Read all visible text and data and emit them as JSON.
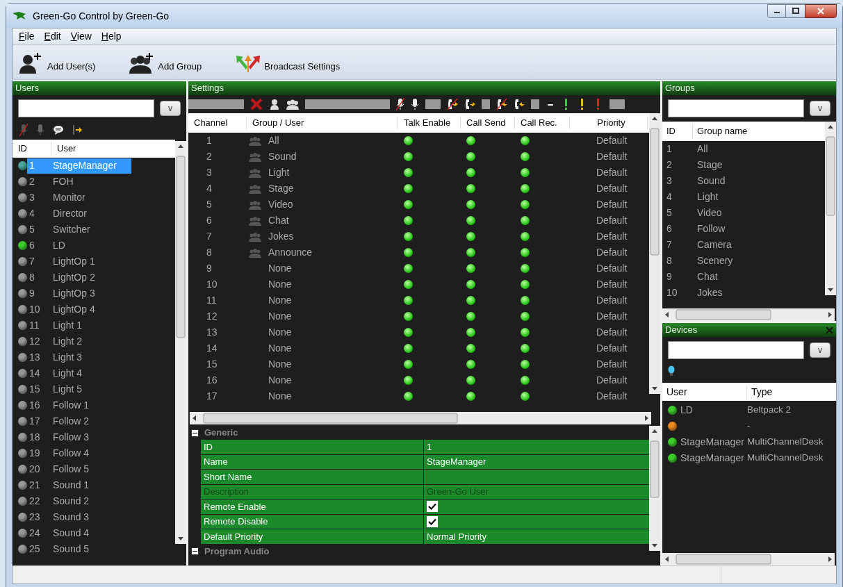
{
  "window": {
    "title": "Green-Go Control by Green-Go"
  },
  "menu": [
    "File",
    "Edit",
    "View",
    "Help"
  ],
  "toolbar": [
    {
      "kind": "user",
      "label": "Add User(s)"
    },
    {
      "kind": "group",
      "label": "Add Group"
    },
    {
      "kind": "broadcast",
      "label": "Broadcast Settings"
    }
  ],
  "users": {
    "title": "Users",
    "filter_button": "v",
    "columns": [
      "ID",
      "User"
    ],
    "rows": [
      {
        "id": "1",
        "name": "StageManager",
        "color": "#4aa6a0",
        "selected": true
      },
      {
        "id": "2",
        "name": "FOH",
        "color": "#9a9a9a",
        "selected": false
      },
      {
        "id": "3",
        "name": "Monitor",
        "color": "#9a9a9a",
        "selected": false
      },
      {
        "id": "4",
        "name": "Director",
        "color": "#9a9a9a",
        "selected": false
      },
      {
        "id": "5",
        "name": "Switcher",
        "color": "#9a9a9a",
        "selected": false
      },
      {
        "id": "6",
        "name": "LD",
        "color": "#3ccf2a",
        "selected": false
      },
      {
        "id": "7",
        "name": "LightOp 1",
        "color": "#9a9a9a",
        "selected": false
      },
      {
        "id": "8",
        "name": "LightOp 2",
        "color": "#9a9a9a",
        "selected": false
      },
      {
        "id": "9",
        "name": "LightOp 3",
        "color": "#9a9a9a",
        "selected": false
      },
      {
        "id": "10",
        "name": "LightOp 4",
        "color": "#9a9a9a",
        "selected": false
      },
      {
        "id": "11",
        "name": "Light 1",
        "color": "#9a9a9a",
        "selected": false
      },
      {
        "id": "12",
        "name": "Light 2",
        "color": "#9a9a9a",
        "selected": false
      },
      {
        "id": "13",
        "name": "Light 3",
        "color": "#9a9a9a",
        "selected": false
      },
      {
        "id": "14",
        "name": "Light 4",
        "color": "#9a9a9a",
        "selected": false
      },
      {
        "id": "15",
        "name": "Light 5",
        "color": "#9a9a9a",
        "selected": false
      },
      {
        "id": "16",
        "name": "Follow 1",
        "color": "#9a9a9a",
        "selected": false
      },
      {
        "id": "17",
        "name": "Follow 2",
        "color": "#9a9a9a",
        "selected": false
      },
      {
        "id": "18",
        "name": "Follow 3",
        "color": "#9a9a9a",
        "selected": false
      },
      {
        "id": "19",
        "name": "Follow 4",
        "color": "#9a9a9a",
        "selected": false
      },
      {
        "id": "20",
        "name": "Follow 5",
        "color": "#9a9a9a",
        "selected": false
      },
      {
        "id": "21",
        "name": "Sound 1",
        "color": "#9a9a9a",
        "selected": false
      },
      {
        "id": "22",
        "name": "Sound 2",
        "color": "#9a9a9a",
        "selected": false
      },
      {
        "id": "23",
        "name": "Sound 3",
        "color": "#9a9a9a",
        "selected": false
      },
      {
        "id": "24",
        "name": "Sound 4",
        "color": "#9a9a9a",
        "selected": false
      },
      {
        "id": "25",
        "name": "Sound 5",
        "color": "#9a9a9a",
        "selected": false
      }
    ]
  },
  "settings": {
    "title": "Settings",
    "columns": [
      "Channel",
      "Group / User",
      "Talk Enable",
      "Call Send",
      "Call Rec.",
      "Priority"
    ],
    "rows": [
      {
        "channel": "1",
        "kind": "group",
        "name": "All",
        "talk_enable": true,
        "call_send": true,
        "call_rec": true,
        "priority": "Default"
      },
      {
        "channel": "2",
        "kind": "group",
        "name": "Sound",
        "talk_enable": true,
        "call_send": true,
        "call_rec": true,
        "priority": "Default"
      },
      {
        "channel": "3",
        "kind": "group",
        "name": "Light",
        "talk_enable": true,
        "call_send": true,
        "call_rec": true,
        "priority": "Default"
      },
      {
        "channel": "4",
        "kind": "group",
        "name": "Stage",
        "talk_enable": true,
        "call_send": true,
        "call_rec": true,
        "priority": "Default"
      },
      {
        "channel": "5",
        "kind": "group",
        "name": "Video",
        "talk_enable": true,
        "call_send": true,
        "call_rec": true,
        "priority": "Default"
      },
      {
        "channel": "6",
        "kind": "group",
        "name": "Chat",
        "talk_enable": true,
        "call_send": true,
        "call_rec": true,
        "priority": "Default"
      },
      {
        "channel": "7",
        "kind": "group",
        "name": "Jokes",
        "talk_enable": true,
        "call_send": true,
        "call_rec": true,
        "priority": "Default"
      },
      {
        "channel": "8",
        "kind": "group",
        "name": "Announce",
        "talk_enable": true,
        "call_send": true,
        "call_rec": true,
        "priority": "Default"
      },
      {
        "channel": "9",
        "kind": "none",
        "name": "None",
        "talk_enable": true,
        "call_send": true,
        "call_rec": true,
        "priority": "Default"
      },
      {
        "channel": "10",
        "kind": "none",
        "name": "None",
        "talk_enable": true,
        "call_send": true,
        "call_rec": true,
        "priority": "Default"
      },
      {
        "channel": "11",
        "kind": "none",
        "name": "None",
        "talk_enable": true,
        "call_send": true,
        "call_rec": true,
        "priority": "Default"
      },
      {
        "channel": "12",
        "kind": "none",
        "name": "None",
        "talk_enable": true,
        "call_send": true,
        "call_rec": true,
        "priority": "Default"
      },
      {
        "channel": "13",
        "kind": "none",
        "name": "None",
        "talk_enable": true,
        "call_send": true,
        "call_rec": true,
        "priority": "Default"
      },
      {
        "channel": "14",
        "kind": "none",
        "name": "None",
        "talk_enable": true,
        "call_send": true,
        "call_rec": true,
        "priority": "Default"
      },
      {
        "channel": "15",
        "kind": "none",
        "name": "None",
        "talk_enable": true,
        "call_send": true,
        "call_rec": true,
        "priority": "Default"
      },
      {
        "channel": "16",
        "kind": "none",
        "name": "None",
        "talk_enable": true,
        "call_send": true,
        "call_rec": true,
        "priority": "Default"
      },
      {
        "channel": "17",
        "kind": "none",
        "name": "None",
        "talk_enable": true,
        "call_send": true,
        "call_rec": true,
        "priority": "Default"
      }
    ],
    "properties": [
      {
        "title": "Generic",
        "expanded": true,
        "rows": [
          {
            "kind": "text",
            "label": "ID",
            "value": "1",
            "disabled": false
          },
          {
            "kind": "text",
            "label": "Name",
            "value": "StageManager",
            "disabled": false
          },
          {
            "kind": "text",
            "label": "Short Name",
            "disabled": false
          },
          {
            "kind": "text",
            "label": "Description",
            "value": "Green-Go User",
            "disabled": true
          },
          {
            "kind": "checkbox",
            "label": "Remote Enable",
            "checked": true,
            "disabled": false
          },
          {
            "kind": "checkbox",
            "label": "Remote Disable",
            "checked": true,
            "disabled": false
          },
          {
            "kind": "text",
            "label": "Default Priority",
            "value": "Normal Priority",
            "disabled": false
          }
        ]
      },
      {
        "title": "Program Audio",
        "expanded": true
      }
    ]
  },
  "groups": {
    "title": "Groups",
    "filter_button": "v",
    "columns": [
      "ID",
      "Group name"
    ],
    "rows": [
      {
        "id": "1",
        "name": "All"
      },
      {
        "id": "2",
        "name": "Stage"
      },
      {
        "id": "3",
        "name": "Sound"
      },
      {
        "id": "4",
        "name": "Light"
      },
      {
        "id": "5",
        "name": "Video"
      },
      {
        "id": "6",
        "name": "Follow"
      },
      {
        "id": "7",
        "name": "Camera"
      },
      {
        "id": "8",
        "name": "Scenery"
      },
      {
        "id": "9",
        "name": "Chat"
      },
      {
        "id": "10",
        "name": "Jokes"
      }
    ]
  },
  "devices": {
    "title": "Devices",
    "filter_button": "v",
    "columns": [
      "User",
      "Type"
    ],
    "rows": [
      {
        "user": "LD",
        "type": "Beltpack 2",
        "color": "#3ccf2a"
      },
      {
        "type": "-",
        "color": "#f08c1e"
      },
      {
        "user": "StageManager",
        "type": "MultiChannelDesk",
        "color": "#3ccf2a"
      },
      {
        "user": "StageManager",
        "type": "MultiChannelDesk",
        "color": "#3ccf2a"
      }
    ]
  }
}
